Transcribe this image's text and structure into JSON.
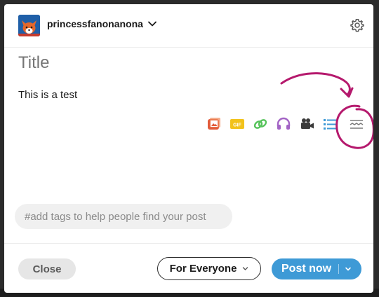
{
  "header": {
    "blog_name": "princessfanonanona",
    "icons": {
      "avatar": "fox-avatar",
      "switcher": "chevron-down-icon",
      "settings": "gear-icon"
    }
  },
  "editor": {
    "title_placeholder": "Title",
    "body_text": "This is a test"
  },
  "toolbar": {
    "items": [
      {
        "name": "photo",
        "icon": "photo-icon",
        "color": "#e25b3a"
      },
      {
        "name": "gif",
        "icon": "gif-icon",
        "label": "GIF",
        "color": "#f2c21b"
      },
      {
        "name": "link",
        "icon": "link-icon",
        "color": "#55c35a"
      },
      {
        "name": "audio",
        "icon": "headphones-icon",
        "color": "#a364c5"
      },
      {
        "name": "video",
        "icon": "video-camera-icon",
        "color": "#3a3a3a"
      },
      {
        "name": "list",
        "icon": "list-icon",
        "color": "#3e9ad6"
      },
      {
        "name": "read-more",
        "icon": "read-more-icon",
        "color": "#7a7a7a"
      }
    ]
  },
  "annotation": {
    "color": "#b5196d"
  },
  "tags": {
    "placeholder": "#add tags to help people find your post"
  },
  "footer": {
    "close_label": "Close",
    "audience_label": "For Everyone",
    "post_label": "Post now"
  },
  "colors": {
    "accent": "#3e9ad6",
    "annotation": "#b5196d"
  }
}
